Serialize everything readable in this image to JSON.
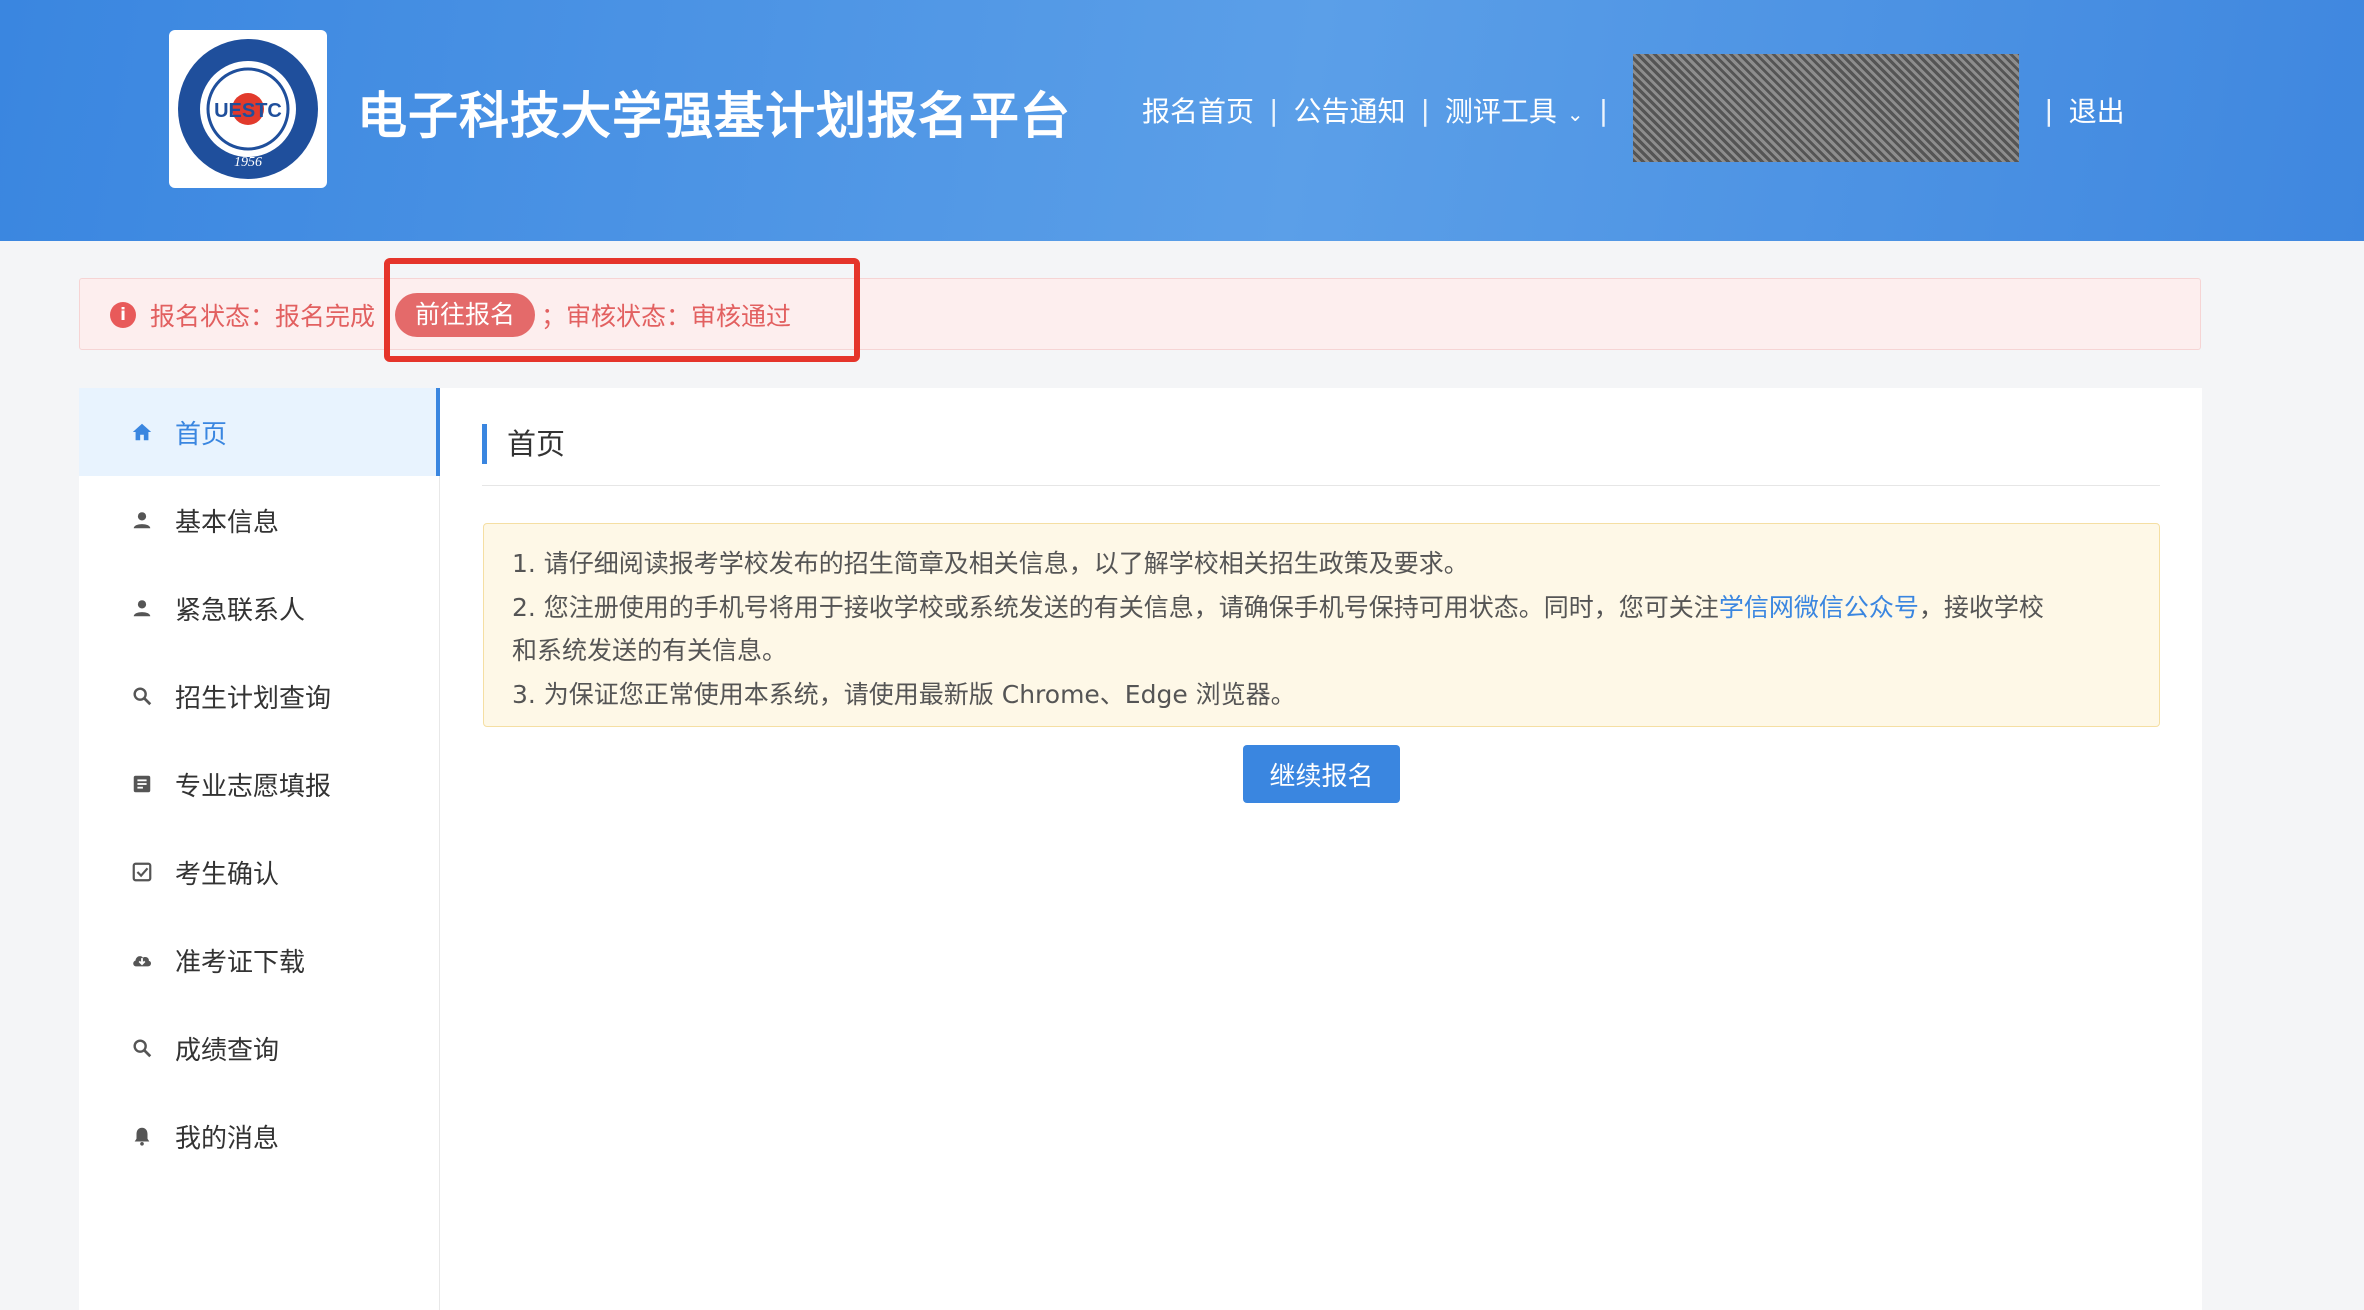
{
  "header": {
    "site_title": "电子科技大学强基计划报名平台",
    "logo_text": "UESTC",
    "logo_year": "1956",
    "nav": {
      "home": "报名首页",
      "notices": "公告通知",
      "tools": "测评工具",
      "logout": "退出"
    }
  },
  "status": {
    "registration_label": "报名状态：报名完成",
    "go_button": "前往报名",
    "separator": "；",
    "review_label": "审核状态：审核通过"
  },
  "sidebar": {
    "items": [
      {
        "label": "首页",
        "icon": "home-icon"
      },
      {
        "label": "基本信息",
        "icon": "user-icon"
      },
      {
        "label": "紧急联系人",
        "icon": "user-icon"
      },
      {
        "label": "招生计划查询",
        "icon": "search-icon"
      },
      {
        "label": "专业志愿填报",
        "icon": "document-icon"
      },
      {
        "label": "考生确认",
        "icon": "checkbox-icon"
      },
      {
        "label": "准考证下载",
        "icon": "cloud-download-icon"
      },
      {
        "label": "成绩查询",
        "icon": "search-icon"
      },
      {
        "label": "我的消息",
        "icon": "bell-icon"
      }
    ]
  },
  "main": {
    "title": "首页",
    "notice": {
      "line1": "1. 请仔细阅读报考学校发布的招生简章及相关信息，以了解学校相关招生政策及要求。",
      "line2_pre": "2. 您注册使用的手机号将用于接收学校或系统发送的有关信息，请确保手机号保持可用状态。同时，您可关注",
      "line2_link": "学信网微信公众号",
      "line2_post": "，接收学校",
      "line2_cont": "和系统发送的有关信息。",
      "line3": "3. 为保证您正常使用本系统，请使用最新版 Chrome、Edge 浏览器。"
    },
    "continue_button": "继续报名"
  },
  "colors": {
    "primary": "#3a86e0",
    "danger": "#e26060",
    "highlight": "#e5352b"
  }
}
